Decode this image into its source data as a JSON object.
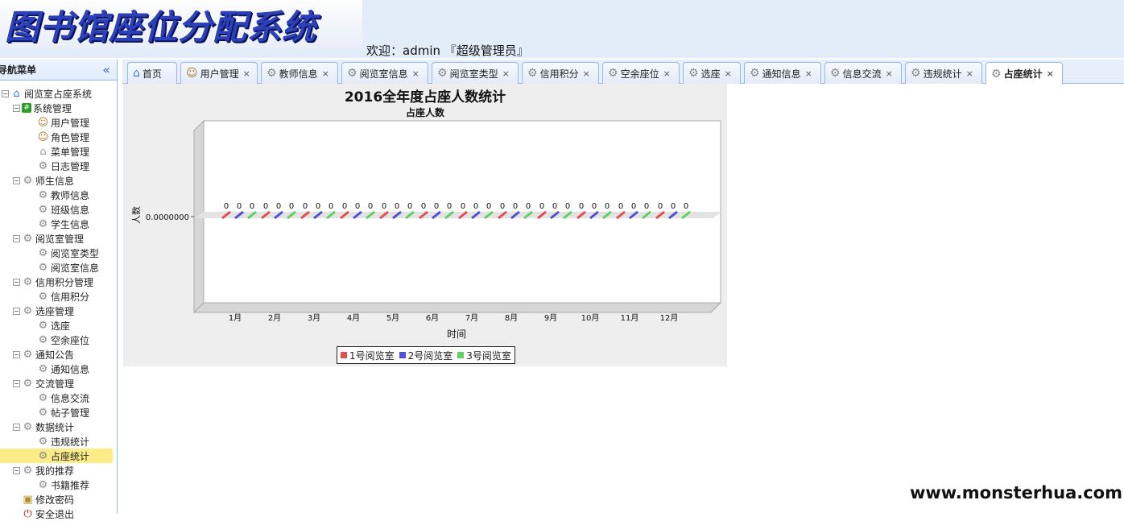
{
  "header": {
    "logo_text": "图书馆座位分配系统",
    "welcome": "欢迎：admin 『超级管理员』"
  },
  "sidebar": {
    "title": "导航菜单",
    "collapse_icon": "double-chevron-left-icon",
    "tree": [
      {
        "label": "阅览室占座系统",
        "icon": "house-icon",
        "level": 0,
        "toggle": "-"
      },
      {
        "label": "系统管理",
        "icon": "grid-icon",
        "level": 1,
        "toggle": "-"
      },
      {
        "label": "用户管理",
        "icon": "users-icon",
        "level": 2
      },
      {
        "label": "角色管理",
        "icon": "users-icon",
        "level": 2
      },
      {
        "label": "菜单管理",
        "icon": "bank-icon",
        "level": 2
      },
      {
        "label": "日志管理",
        "icon": "gear-icon",
        "level": 2
      },
      {
        "label": "师生信息",
        "icon": "gear-icon",
        "level": 1,
        "toggle": "-"
      },
      {
        "label": "教师信息",
        "icon": "gear-icon",
        "level": 2
      },
      {
        "label": "班级信息",
        "icon": "gear-icon",
        "level": 2
      },
      {
        "label": "学生信息",
        "icon": "gear-icon",
        "level": 2
      },
      {
        "label": "阅览室管理",
        "icon": "gear-icon",
        "level": 1,
        "toggle": "-"
      },
      {
        "label": "阅览室类型",
        "icon": "gear-icon",
        "level": 2
      },
      {
        "label": "阅览室信息",
        "icon": "gear-icon",
        "level": 2
      },
      {
        "label": "信用积分管理",
        "icon": "gear-icon",
        "level": 1,
        "toggle": "-"
      },
      {
        "label": "信用积分",
        "icon": "gear-icon",
        "level": 2
      },
      {
        "label": "选座管理",
        "icon": "gear-icon",
        "level": 1,
        "toggle": "-"
      },
      {
        "label": "选座",
        "icon": "gear-icon",
        "level": 2
      },
      {
        "label": "空余座位",
        "icon": "gear-icon",
        "level": 2
      },
      {
        "label": "通知公告",
        "icon": "gear-icon",
        "level": 1,
        "toggle": "-"
      },
      {
        "label": "通知信息",
        "icon": "gear-icon",
        "level": 2
      },
      {
        "label": "交流管理",
        "icon": "gear-icon",
        "level": 1,
        "toggle": "-"
      },
      {
        "label": "信息交流",
        "icon": "gear-icon",
        "level": 2
      },
      {
        "label": "帖子管理",
        "icon": "gear-icon",
        "level": 2
      },
      {
        "label": "数据统计",
        "icon": "gear-icon",
        "level": 1,
        "toggle": "-"
      },
      {
        "label": "违规统计",
        "icon": "gear-icon",
        "level": 2
      },
      {
        "label": "占座统计",
        "icon": "gear-icon",
        "level": 2,
        "selected": true
      },
      {
        "label": "我的推荐",
        "icon": "gear-icon",
        "level": 1,
        "toggle": "-"
      },
      {
        "label": "书籍推荐",
        "icon": "gear-icon",
        "level": 2
      },
      {
        "label": "修改密码",
        "icon": "lock-icon",
        "level": 1
      },
      {
        "label": "安全退出",
        "icon": "power-icon",
        "level": 1
      }
    ]
  },
  "tabs": [
    {
      "label": "首页",
      "icon": "home-icon",
      "closable": false
    },
    {
      "label": "用户管理",
      "icon": "users-icon",
      "closable": true
    },
    {
      "label": "教师信息",
      "icon": "gear-icon",
      "closable": true
    },
    {
      "label": "阅览室信息",
      "icon": "gear-icon",
      "closable": true
    },
    {
      "label": "阅览室类型",
      "icon": "gear-icon",
      "closable": true
    },
    {
      "label": "信用积分",
      "icon": "gear-icon",
      "closable": true
    },
    {
      "label": "空余座位",
      "icon": "gear-icon",
      "closable": true
    },
    {
      "label": "选座",
      "icon": "gear-icon",
      "closable": true
    },
    {
      "label": "通知信息",
      "icon": "gear-icon",
      "closable": true
    },
    {
      "label": "信息交流",
      "icon": "gear-icon",
      "closable": true
    },
    {
      "label": "违规统计",
      "icon": "gear-icon",
      "closable": true
    },
    {
      "label": "占座统计",
      "icon": "gear-icon",
      "closable": true,
      "active": true
    }
  ],
  "tab_close_glyph": "×",
  "chart_data": {
    "type": "bar",
    "title": "2016全年度占座人数统计",
    "subtitle": "占座人数",
    "xlabel": "时间",
    "ylabel": "人数",
    "y_tick_labels": [
      "0.0000000"
    ],
    "categories": [
      "1月",
      "2月",
      "3月",
      "4月",
      "5月",
      "6月",
      "7月",
      "8月",
      "9月",
      "10月",
      "11月",
      "12月"
    ],
    "series": [
      {
        "name": "1号阅览室",
        "color": "#e05050",
        "values": [
          0,
          0,
          0,
          0,
          0,
          0,
          0,
          0,
          0,
          0,
          0,
          0
        ]
      },
      {
        "name": "2号阅览室",
        "color": "#5050d8",
        "values": [
          0,
          0,
          0,
          0,
          0,
          0,
          0,
          0,
          0,
          0,
          0,
          0
        ]
      },
      {
        "name": "3号阅览室",
        "color": "#60d060",
        "values": [
          0,
          0,
          0,
          0,
          0,
          0,
          0,
          0,
          0,
          0,
          0,
          0
        ]
      }
    ],
    "data_labels": true,
    "legend_position": "bottom",
    "style": "3d"
  },
  "watermark": "www.monsterhua.com"
}
